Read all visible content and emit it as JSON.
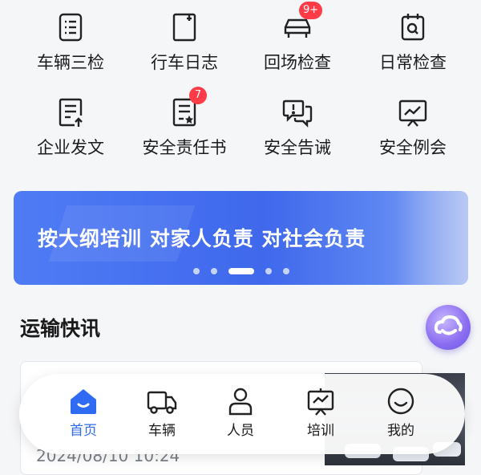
{
  "grid": [
    {
      "label": "车辆三检",
      "icon": "checklist-icon"
    },
    {
      "label": "行车日志",
      "icon": "log-book-icon"
    },
    {
      "label": "回场检查",
      "icon": "car-icon",
      "badge": "9+"
    },
    {
      "label": "日常检查",
      "icon": "calendar-search-icon"
    },
    {
      "label": "企业发文",
      "icon": "document-upload-icon"
    },
    {
      "label": "安全责任书",
      "icon": "document-star-icon",
      "badge": "7"
    },
    {
      "label": "安全告诫",
      "icon": "alert-chat-icon"
    },
    {
      "label": "安全例会",
      "icon": "chart-board-icon"
    }
  ],
  "banner": {
    "text": "按大纲培训 对家人负责 对社会负责",
    "active_dot": 2,
    "dot_count": 5
  },
  "section_title": "运输快讯",
  "news": {
    "date": "2024/08/10 10:24"
  },
  "tabbar": [
    {
      "label": "首页",
      "icon": "home-icon",
      "active": true
    },
    {
      "label": "车辆",
      "icon": "truck-icon",
      "active": false
    },
    {
      "label": "人员",
      "icon": "person-icon",
      "active": false
    },
    {
      "label": "培训",
      "icon": "training-board-icon",
      "active": false
    },
    {
      "label": "我的",
      "icon": "smile-icon",
      "active": false
    }
  ],
  "colors": {
    "accent": "#2f6bf2",
    "badge": "#ff3b47",
    "banner": "#4a74f1"
  }
}
